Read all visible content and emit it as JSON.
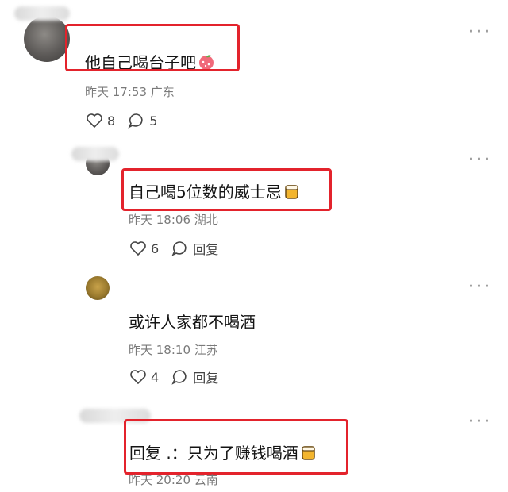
{
  "comments": [
    {
      "text": "他自己喝台子吧",
      "emoji": "peach-emoji",
      "time": "昨天 17:53",
      "location": "广东",
      "likes": "8",
      "replies": "5",
      "highlighted": true
    },
    {
      "text": "自己喝5位数的威士忌",
      "emoji": "beer-emoji",
      "time": "昨天 18:06",
      "location": "湖北",
      "likes": "6",
      "reply_label": "回复",
      "highlighted": true
    },
    {
      "text": "或许人家都不喝酒",
      "time": "昨天 18:10",
      "location": "江苏",
      "likes": "4",
      "reply_label": "回复",
      "highlighted": false
    },
    {
      "text": "回复 .：只为了赚钱喝酒",
      "emoji": "beer-emoji",
      "time": "昨天 20:20",
      "location": "云南",
      "highlighted": true
    }
  ],
  "colors": {
    "highlight": "#e3232c",
    "meta": "#7a7a7a"
  }
}
